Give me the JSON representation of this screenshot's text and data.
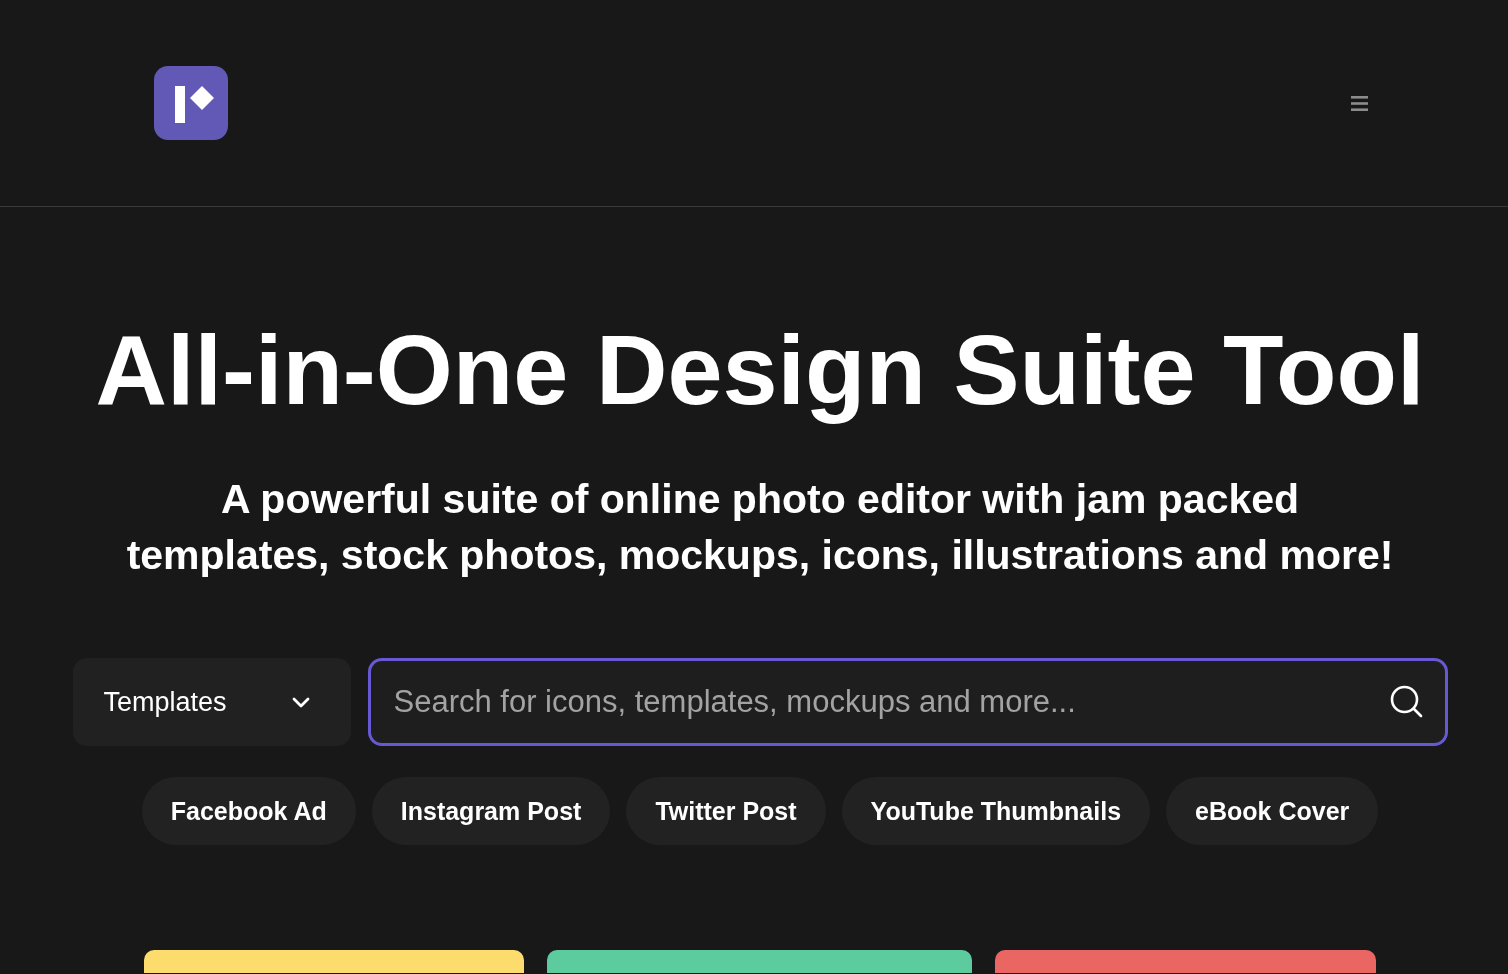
{
  "hero": {
    "title": "All-in-One Design Suite Tool",
    "subtitle": "A powerful suite of online photo editor with jam packed templates, stock photos, mockups, icons, illustrations and more!"
  },
  "search": {
    "category": "Templates",
    "placeholder": "Search for icons, templates, mockups and more...",
    "focused": true
  },
  "tags": [
    "Facebook Ad",
    "Instagram Post",
    "Twitter Post",
    "YouTube Thumbnails",
    "eBook Cover"
  ],
  "template_cards": [
    {
      "color": "#fbdc6c"
    },
    {
      "color": "#5ccb9d"
    },
    {
      "color": "#e96662"
    }
  ]
}
